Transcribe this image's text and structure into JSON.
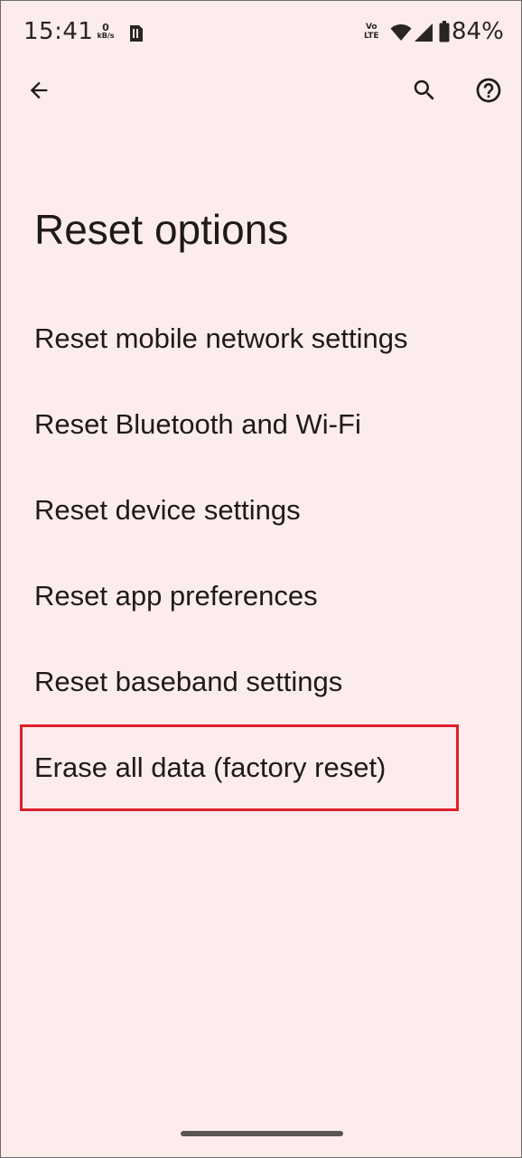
{
  "status_bar": {
    "time": "15:41",
    "net_speed_value": "0",
    "net_speed_unit": "kB/s",
    "volte_top": "Vo",
    "volte_bottom": "LTE",
    "battery_percent": "84%",
    "battery_level": 0.84,
    "icons": [
      "sim-icon",
      "volte-icon",
      "wifi-icon",
      "signal-icon",
      "battery-icon"
    ]
  },
  "app_bar": {
    "icons": [
      "back-arrow-icon",
      "search-icon",
      "help-icon"
    ]
  },
  "page": {
    "title": "Reset options"
  },
  "options": [
    {
      "label": "Reset mobile network settings"
    },
    {
      "label": "Reset Bluetooth and Wi-Fi"
    },
    {
      "label": "Reset device settings"
    },
    {
      "label": "Reset app preferences"
    },
    {
      "label": "Reset baseband settings"
    },
    {
      "label": "Erase all data (factory reset)",
      "highlighted": true
    }
  ],
  "colors": {
    "background": "#fdecec",
    "text": "#1f1a1a",
    "highlight": "#e0202a"
  }
}
